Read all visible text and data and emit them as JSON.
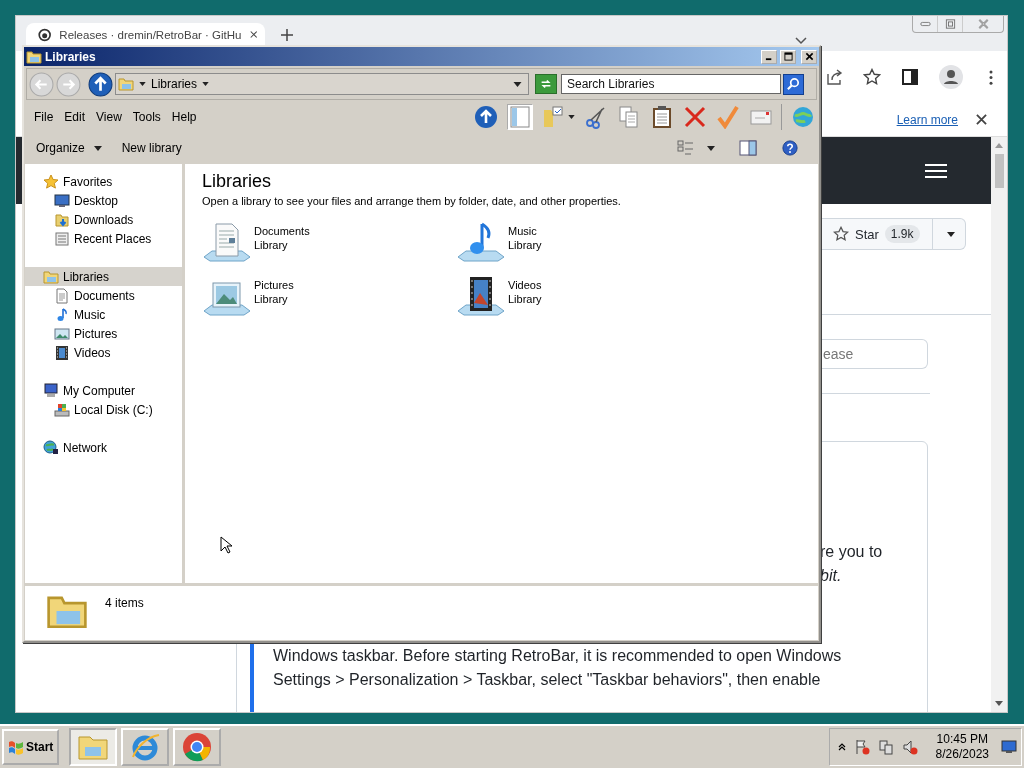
{
  "browser": {
    "tab": {
      "title": "Releases · dremin/RetroBar · GitHu"
    },
    "infobar": {
      "link": "Learn more"
    },
    "star_button": {
      "label": "Star",
      "count": "1.9k"
    },
    "release_search": {
      "placeholder": "ease"
    },
    "fragments": [
      {
        "text": "re you to",
        "italic": false
      },
      {
        "text": "bit.",
        "italic": true
      }
    ],
    "notice": {
      "lines": [
        "Windows taskbar. Before starting RetroBar, it is recommended to open Windows",
        "Settings > Personalization > Taskbar, select \"Taskbar behaviors\", then enable"
      ]
    }
  },
  "explorer": {
    "title": "Libraries",
    "address": {
      "crumb": "Libraries"
    },
    "search": {
      "placeholder": "Search Libraries"
    },
    "menu": [
      "File",
      "Edit",
      "View",
      "Tools",
      "Help"
    ],
    "commands": [
      {
        "label": "Organize",
        "dropdown": true
      },
      {
        "label": "New library",
        "dropdown": false
      }
    ],
    "nav": [
      {
        "label": "Favorites",
        "kind": "favorites",
        "selected": false,
        "children": [
          {
            "label": "Desktop",
            "kind": "desktop",
            "selected": false
          },
          {
            "label": "Downloads",
            "kind": "downloads",
            "selected": false
          },
          {
            "label": "Recent Places",
            "kind": "recent",
            "selected": false
          }
        ]
      },
      {
        "label": "Libraries",
        "kind": "libraries",
        "selected": true,
        "children": [
          {
            "label": "Documents",
            "kind": "documents",
            "selected": false
          },
          {
            "label": "Music",
            "kind": "music",
            "selected": false
          },
          {
            "label": "Pictures",
            "kind": "pictures",
            "selected": false
          },
          {
            "label": "Videos",
            "kind": "videos",
            "selected": false
          }
        ]
      },
      {
        "label": "My Computer",
        "kind": "computer",
        "selected": false,
        "children": [
          {
            "label": "Local Disk (C:)",
            "kind": "disk",
            "selected": false
          }
        ]
      },
      {
        "label": "Network",
        "kind": "network",
        "selected": false
      }
    ],
    "heading": "Libraries",
    "description": "Open a library to see your files and arrange them by folder, date, and other properties.",
    "libraries": [
      {
        "name": "Documents",
        "type": "Library",
        "kind": "documents"
      },
      {
        "name": "Music",
        "type": "Library",
        "kind": "music"
      },
      {
        "name": "Pictures",
        "type": "Library",
        "kind": "pictures"
      },
      {
        "name": "Videos",
        "type": "Library",
        "kind": "videos"
      }
    ],
    "status": "4 items"
  },
  "taskbar": {
    "start": "Start",
    "apps": [
      {
        "kind": "explorer",
        "selected": true
      },
      {
        "kind": "ie",
        "selected": false
      },
      {
        "kind": "chrome",
        "selected": false
      }
    ],
    "clock": {
      "time": "10:45 PM",
      "date": "8/26/2023"
    }
  }
}
